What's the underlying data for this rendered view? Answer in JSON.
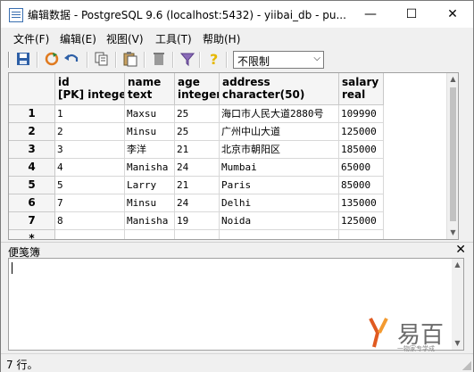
{
  "window": {
    "title": "编辑数据 - PostgreSQL 9.6 (localhost:5432) - yiibai_db - pu...",
    "minimize": "—",
    "maximize": "☐",
    "close": "✕"
  },
  "menu": {
    "items": [
      "文件(F)",
      "编辑(E)",
      "视图(V)",
      "工具(T)",
      "帮助(H)"
    ]
  },
  "toolbar": {
    "icons": [
      "save-icon",
      "refresh-icon",
      "undo-icon",
      "copy-icon",
      "paste-icon",
      "delete-icon",
      "filter-icon",
      "help-icon"
    ],
    "limit_value": "不限制",
    "limit_arrow": "⌵"
  },
  "grid": {
    "columns": [
      {
        "name": "id",
        "type": "[PK] integer"
      },
      {
        "name": "name",
        "type": "text"
      },
      {
        "name": "age",
        "type": "integer"
      },
      {
        "name": "address",
        "type": "character(50)"
      },
      {
        "name": "salary",
        "type": "real"
      }
    ],
    "rows": [
      {
        "num": "1",
        "cells": [
          "1",
          "Maxsu",
          "25",
          "海口市人民大道2880号",
          "109990"
        ]
      },
      {
        "num": "2",
        "cells": [
          "2",
          "Minsu",
          "25",
          "广州中山大道",
          "125000"
        ]
      },
      {
        "num": "3",
        "cells": [
          "3",
          "李洋",
          "21",
          "北京市朝阳区",
          "185000"
        ]
      },
      {
        "num": "4",
        "cells": [
          "4",
          "Manisha",
          "24",
          "Mumbai",
          "65000"
        ]
      },
      {
        "num": "5",
        "cells": [
          "5",
          "Larry",
          "21",
          "Paris",
          "85000"
        ]
      },
      {
        "num": "6",
        "cells": [
          "7",
          "Minsu",
          "24",
          "Delhi",
          "135000"
        ]
      },
      {
        "num": "7",
        "cells": [
          "8",
          "Manisha",
          "19",
          "Noida",
          "125000"
        ]
      },
      {
        "num": "*",
        "cells": [
          "",
          "",
          "",
          "",
          ""
        ]
      }
    ]
  },
  "scratch": {
    "title": "便笺簿",
    "close": "✕"
  },
  "status": {
    "text": "7 行。"
  },
  "watermark": {
    "text": "易百",
    "sub": "一物家专学成"
  }
}
